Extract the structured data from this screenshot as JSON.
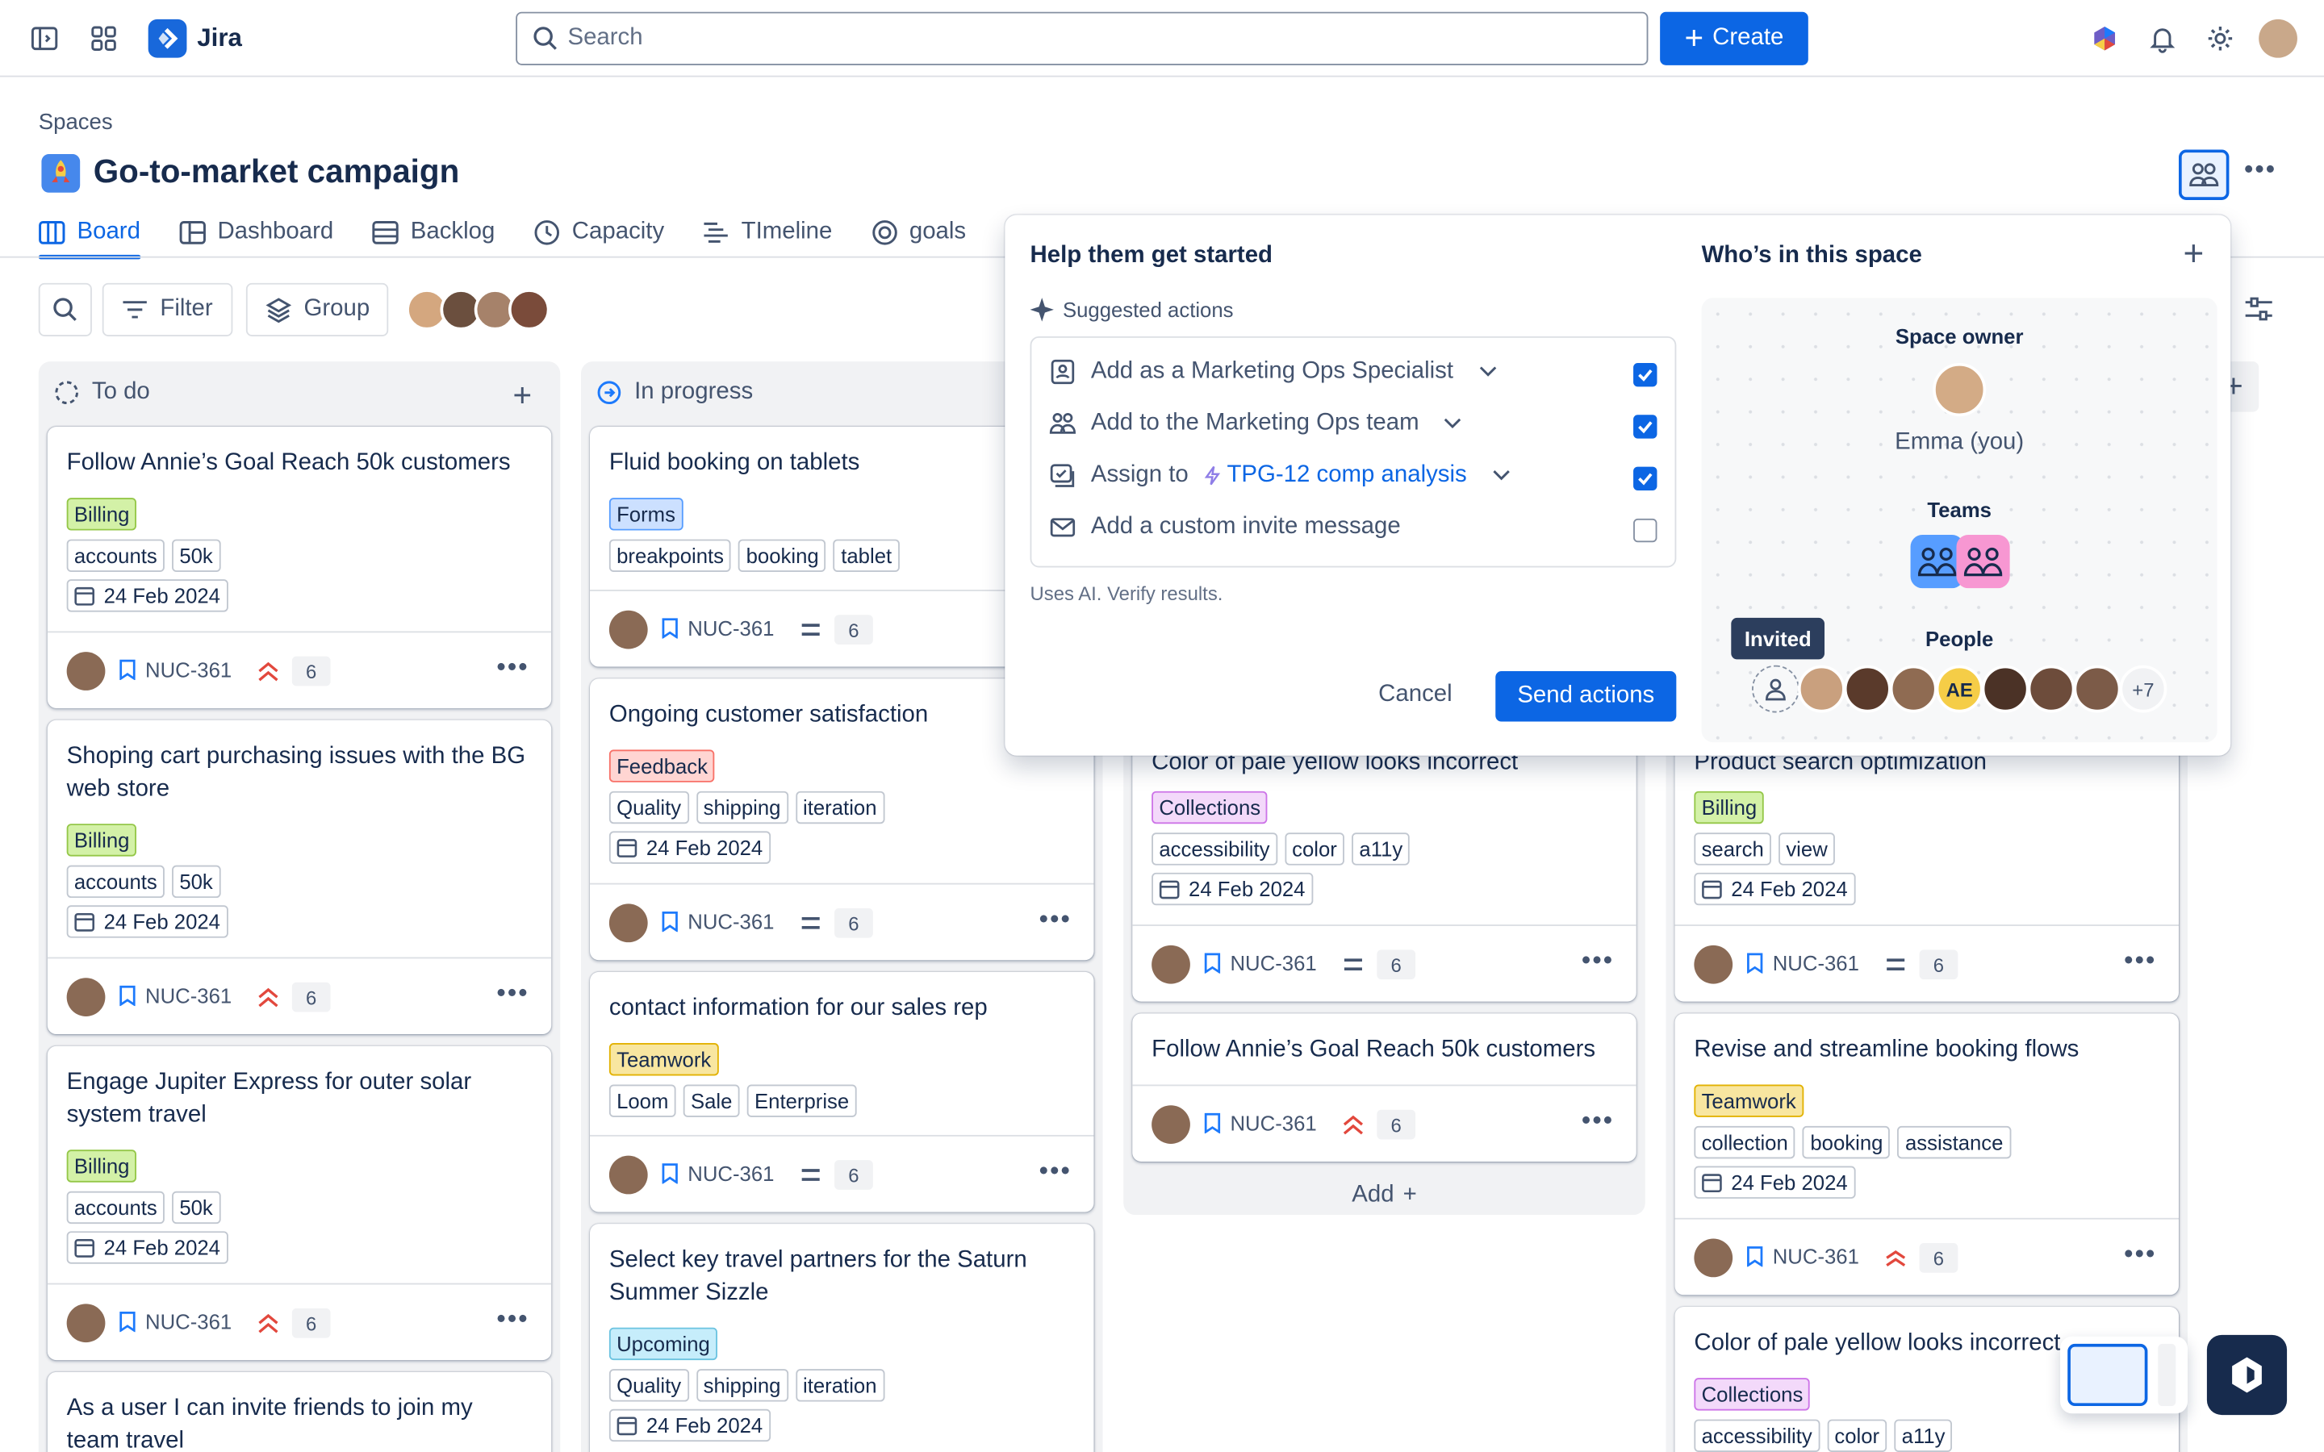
{
  "app": {
    "name": "Jira"
  },
  "search": {
    "placeholder": "Search"
  },
  "create_label": "Create",
  "breadcrumb": "Spaces",
  "project_title": "Go-to-market campaign",
  "tabs": [
    {
      "label": "Board"
    },
    {
      "label": "Dashboard"
    },
    {
      "label": "Backlog"
    },
    {
      "label": "Capacity"
    },
    {
      "label": "TImeline"
    },
    {
      "label": "goals"
    }
  ],
  "toolbar": {
    "filter": "Filter",
    "group": "Group"
  },
  "columns": [
    {
      "title": "To do",
      "cards": [
        {
          "title": "Follow Annie’s Goal Reach 50k customers",
          "label": "Billing",
          "tags": [
            "accounts",
            "50k"
          ],
          "date": "24 Feb 2024",
          "key": "NUC-361",
          "count": "6"
        },
        {
          "title": "Shoping cart purchasing issues with the BG web store",
          "label": "Billing",
          "tags": [
            "accounts",
            "50k"
          ],
          "date": "24 Feb 2024",
          "key": "NUC-361",
          "count": "6"
        },
        {
          "title": "Engage Jupiter Express for outer solar system travel",
          "label": "Billing",
          "tags": [
            "accounts",
            "50k"
          ],
          "date": "24 Feb 2024",
          "key": "NUC-361",
          "count": "6"
        },
        {
          "title": "As a user I can invite friends to join my team travel"
        }
      ]
    },
    {
      "title": "In progress",
      "cards": [
        {
          "title": "Fluid booking on tablets",
          "label": "Forms",
          "tags": [
            "breakpoints",
            "booking",
            "tablet"
          ],
          "key": "NUC-361",
          "count": "6"
        },
        {
          "title": "Ongoing customer satisfaction",
          "label": "Feedback",
          "tags": [
            "Quality",
            "shipping",
            "iteration"
          ],
          "date": "24 Feb 2024",
          "key": "NUC-361",
          "count": "6"
        },
        {
          "title": "contact information for our sales rep",
          "label": "Teamwork",
          "tags": [
            "Loom",
            "Sale",
            "Enterprise"
          ],
          "key": "NUC-361",
          "count": "6"
        },
        {
          "title": "Select key travel partners for the Saturn Summer Sizzle",
          "label": "Upcoming",
          "tags": [
            "Quality",
            "shipping",
            "iteration"
          ],
          "date": "24 Feb 2024"
        }
      ]
    },
    {
      "title": "",
      "cards": [
        {
          "title": "Color of pale yellow looks incorrect",
          "label": "Collections",
          "tags": [
            "accessibility",
            "color",
            "a11y"
          ],
          "date": "24 Feb 2024",
          "key": "NUC-361",
          "count": "6"
        },
        {
          "title": "Follow Annie’s Goal Reach 50k customers",
          "key": "NUC-361",
          "count": "6"
        }
      ],
      "add_label": "Add"
    },
    {
      "title": "",
      "cards": [
        {
          "title": "Product search optimization",
          "label": "Billing",
          "tags": [
            "search",
            "view"
          ],
          "date": "24 Feb 2024",
          "key": "NUC-361",
          "count": "6"
        },
        {
          "title": "Revise and streamline booking flows",
          "label": "Teamwork",
          "tags": [
            "collection",
            "booking",
            "assistance"
          ],
          "date": "24 Feb 2024",
          "key": "NUC-361",
          "count": "6"
        },
        {
          "title": "Color of pale yellow looks incorrect",
          "label": "Collections",
          "tags": [
            "accessibility",
            "color",
            "a11y"
          ]
        }
      ]
    }
  ],
  "popup": {
    "title": "Help them get started",
    "suggested": "Suggested actions",
    "actions": [
      {
        "text": "Add as a Marketing Ops Specialist",
        "checked": true
      },
      {
        "text": "Add to the Marketing Ops team",
        "checked": true
      },
      {
        "text": "Assign to",
        "link": "TPG-12 comp analysis",
        "checked": true
      },
      {
        "text": "Add a custom invite message",
        "checked": false
      }
    ],
    "disclaimer": "Uses AI. Verify results.",
    "cancel": "Cancel",
    "send": "Send actions",
    "space_title": "Who’s in this space",
    "owner_label": "Space owner",
    "owner_name": "Emma (you)",
    "teams_label": "Teams",
    "people_label": "People",
    "invited_tooltip": "Invited",
    "initials": "AE",
    "more": "+7"
  },
  "colors": {
    "accent": "#0c66e4",
    "billing": "#d3f1a7",
    "forms": "#cce0ff",
    "feedback": "#ffd5d2",
    "teamwork": "#f8e6a0",
    "collections": "#f3d9fa",
    "upcoming": "#c6edfb"
  }
}
